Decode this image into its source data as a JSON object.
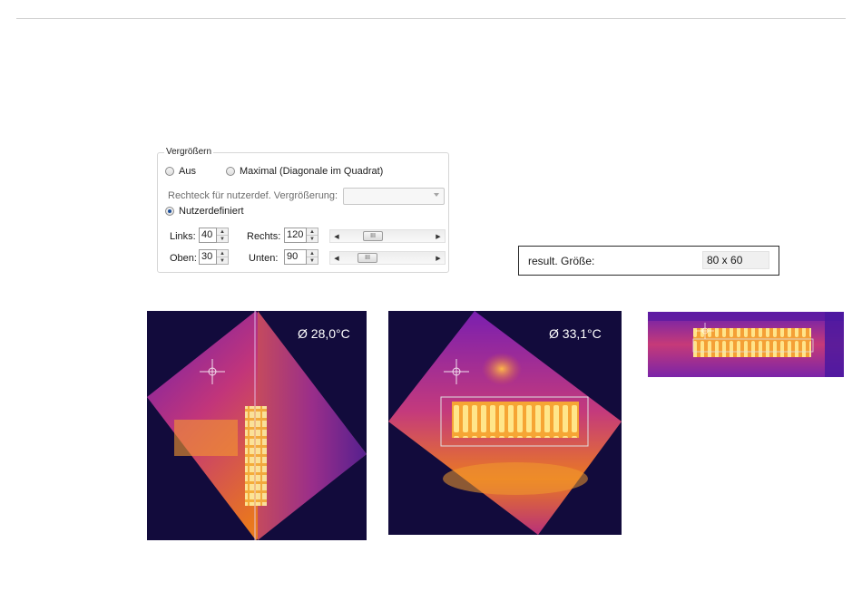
{
  "zoom_group": {
    "title": "Vergrößern",
    "option_off": "Aus",
    "option_max": "Maximal (Diagonale im Quadrat)",
    "rect_label": "Rechteck für nutzerdef. Vergrößerung:",
    "rect_value": "",
    "option_custom": "Nutzerdefiniert",
    "selected": "Nutzerdefiniert",
    "left_label": "Links:",
    "left_value": "40",
    "right_label": "Rechts:",
    "right_value": "120",
    "top_label": "Oben:",
    "top_value": "30",
    "bottom_label": "Unten:",
    "bottom_value": "90",
    "scroll_thumb_glyph": "III"
  },
  "result": {
    "label": "result. Größe:",
    "value": "80 x 60"
  },
  "thermal_images": [
    {
      "temperature": "Ø 28,0°C",
      "palette": "iron"
    },
    {
      "temperature": "Ø 33,1°C",
      "palette": "iron"
    },
    {
      "temperature": "",
      "palette": "iron"
    }
  ],
  "colors": {
    "background_dark": "#110b3d",
    "purple": "#7a1fb0",
    "magenta": "#c0307a",
    "orange": "#f08a1a",
    "yellow": "#ffe27a",
    "radio_selected": "#1d4f9a"
  }
}
